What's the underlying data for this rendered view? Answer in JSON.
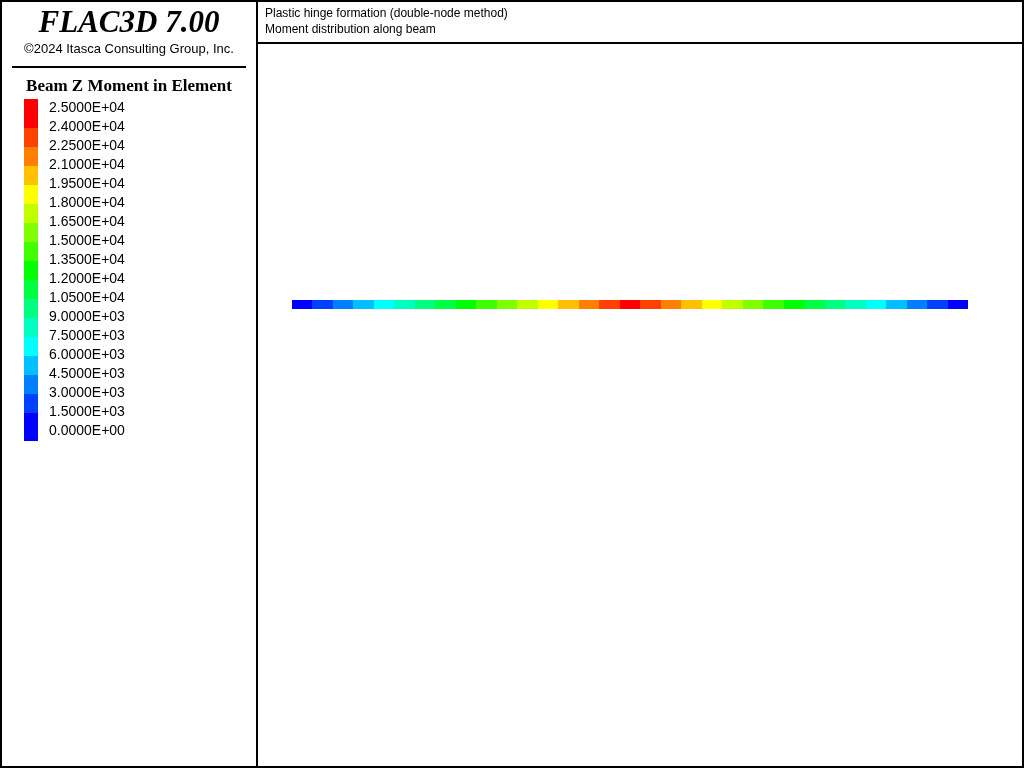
{
  "sidebar": {
    "product_title": "FLAC3D 7.00",
    "copyright": "©2024 Itasca Consulting Group, Inc.",
    "legend": {
      "title": "Beam Z Moment in Element",
      "labels": [
        "2.5000E+04",
        "2.4000E+04",
        "2.2500E+04",
        "2.1000E+04",
        "1.9500E+04",
        "1.8000E+04",
        "1.6500E+04",
        "1.5000E+04",
        "1.3500E+04",
        "1.2000E+04",
        "1.0500E+04",
        "9.0000E+03",
        "7.5000E+03",
        "6.0000E+03",
        "4.5000E+03",
        "3.0000E+03",
        "1.5000E+03",
        "0.0000E+00"
      ],
      "colors": [
        {
          "color": "#ff0000"
        },
        {
          "color": "#ff4000"
        },
        {
          "color": "#ff8000"
        },
        {
          "color": "#ffc000"
        },
        {
          "color": "#ffff00"
        },
        {
          "color": "#c0ff00"
        },
        {
          "color": "#80ff00"
        },
        {
          "color": "#40ff00"
        },
        {
          "color": "#00ff00"
        },
        {
          "color": "#00ff40"
        },
        {
          "color": "#00ff80"
        },
        {
          "color": "#00ffc0"
        },
        {
          "color": "#00ffff"
        },
        {
          "color": "#00c0ff"
        },
        {
          "color": "#0080ff"
        },
        {
          "color": "#0040ff"
        },
        {
          "color": "#0000ff"
        }
      ]
    }
  },
  "header": {
    "lines": [
      "Plastic hinge formation (double-node method)",
      "Moment distribution along beam"
    ]
  },
  "beam": {
    "segments": [
      {
        "color": "#0000ff"
      },
      {
        "color": "#0040ff"
      },
      {
        "color": "#0080ff"
      },
      {
        "color": "#00c0ff"
      },
      {
        "color": "#00ffff"
      },
      {
        "color": "#00ffc0"
      },
      {
        "color": "#00ff80"
      },
      {
        "color": "#00ff40"
      },
      {
        "color": "#00ff00"
      },
      {
        "color": "#40ff00"
      },
      {
        "color": "#80ff00"
      },
      {
        "color": "#c0ff00"
      },
      {
        "color": "#ffff00"
      },
      {
        "color": "#ffc000"
      },
      {
        "color": "#ff8000"
      },
      {
        "color": "#ff4000"
      },
      {
        "color": "#ff0000"
      },
      {
        "color": "#ff4000"
      },
      {
        "color": "#ff8000"
      },
      {
        "color": "#ffc000"
      },
      {
        "color": "#ffff00"
      },
      {
        "color": "#c0ff00"
      },
      {
        "color": "#80ff00"
      },
      {
        "color": "#40ff00"
      },
      {
        "color": "#00ff00"
      },
      {
        "color": "#00ff40"
      },
      {
        "color": "#00ff80"
      },
      {
        "color": "#00ffc0"
      },
      {
        "color": "#00ffff"
      },
      {
        "color": "#00c0ff"
      },
      {
        "color": "#0080ff"
      },
      {
        "color": "#0040ff"
      },
      {
        "color": "#0000ff"
      }
    ]
  }
}
